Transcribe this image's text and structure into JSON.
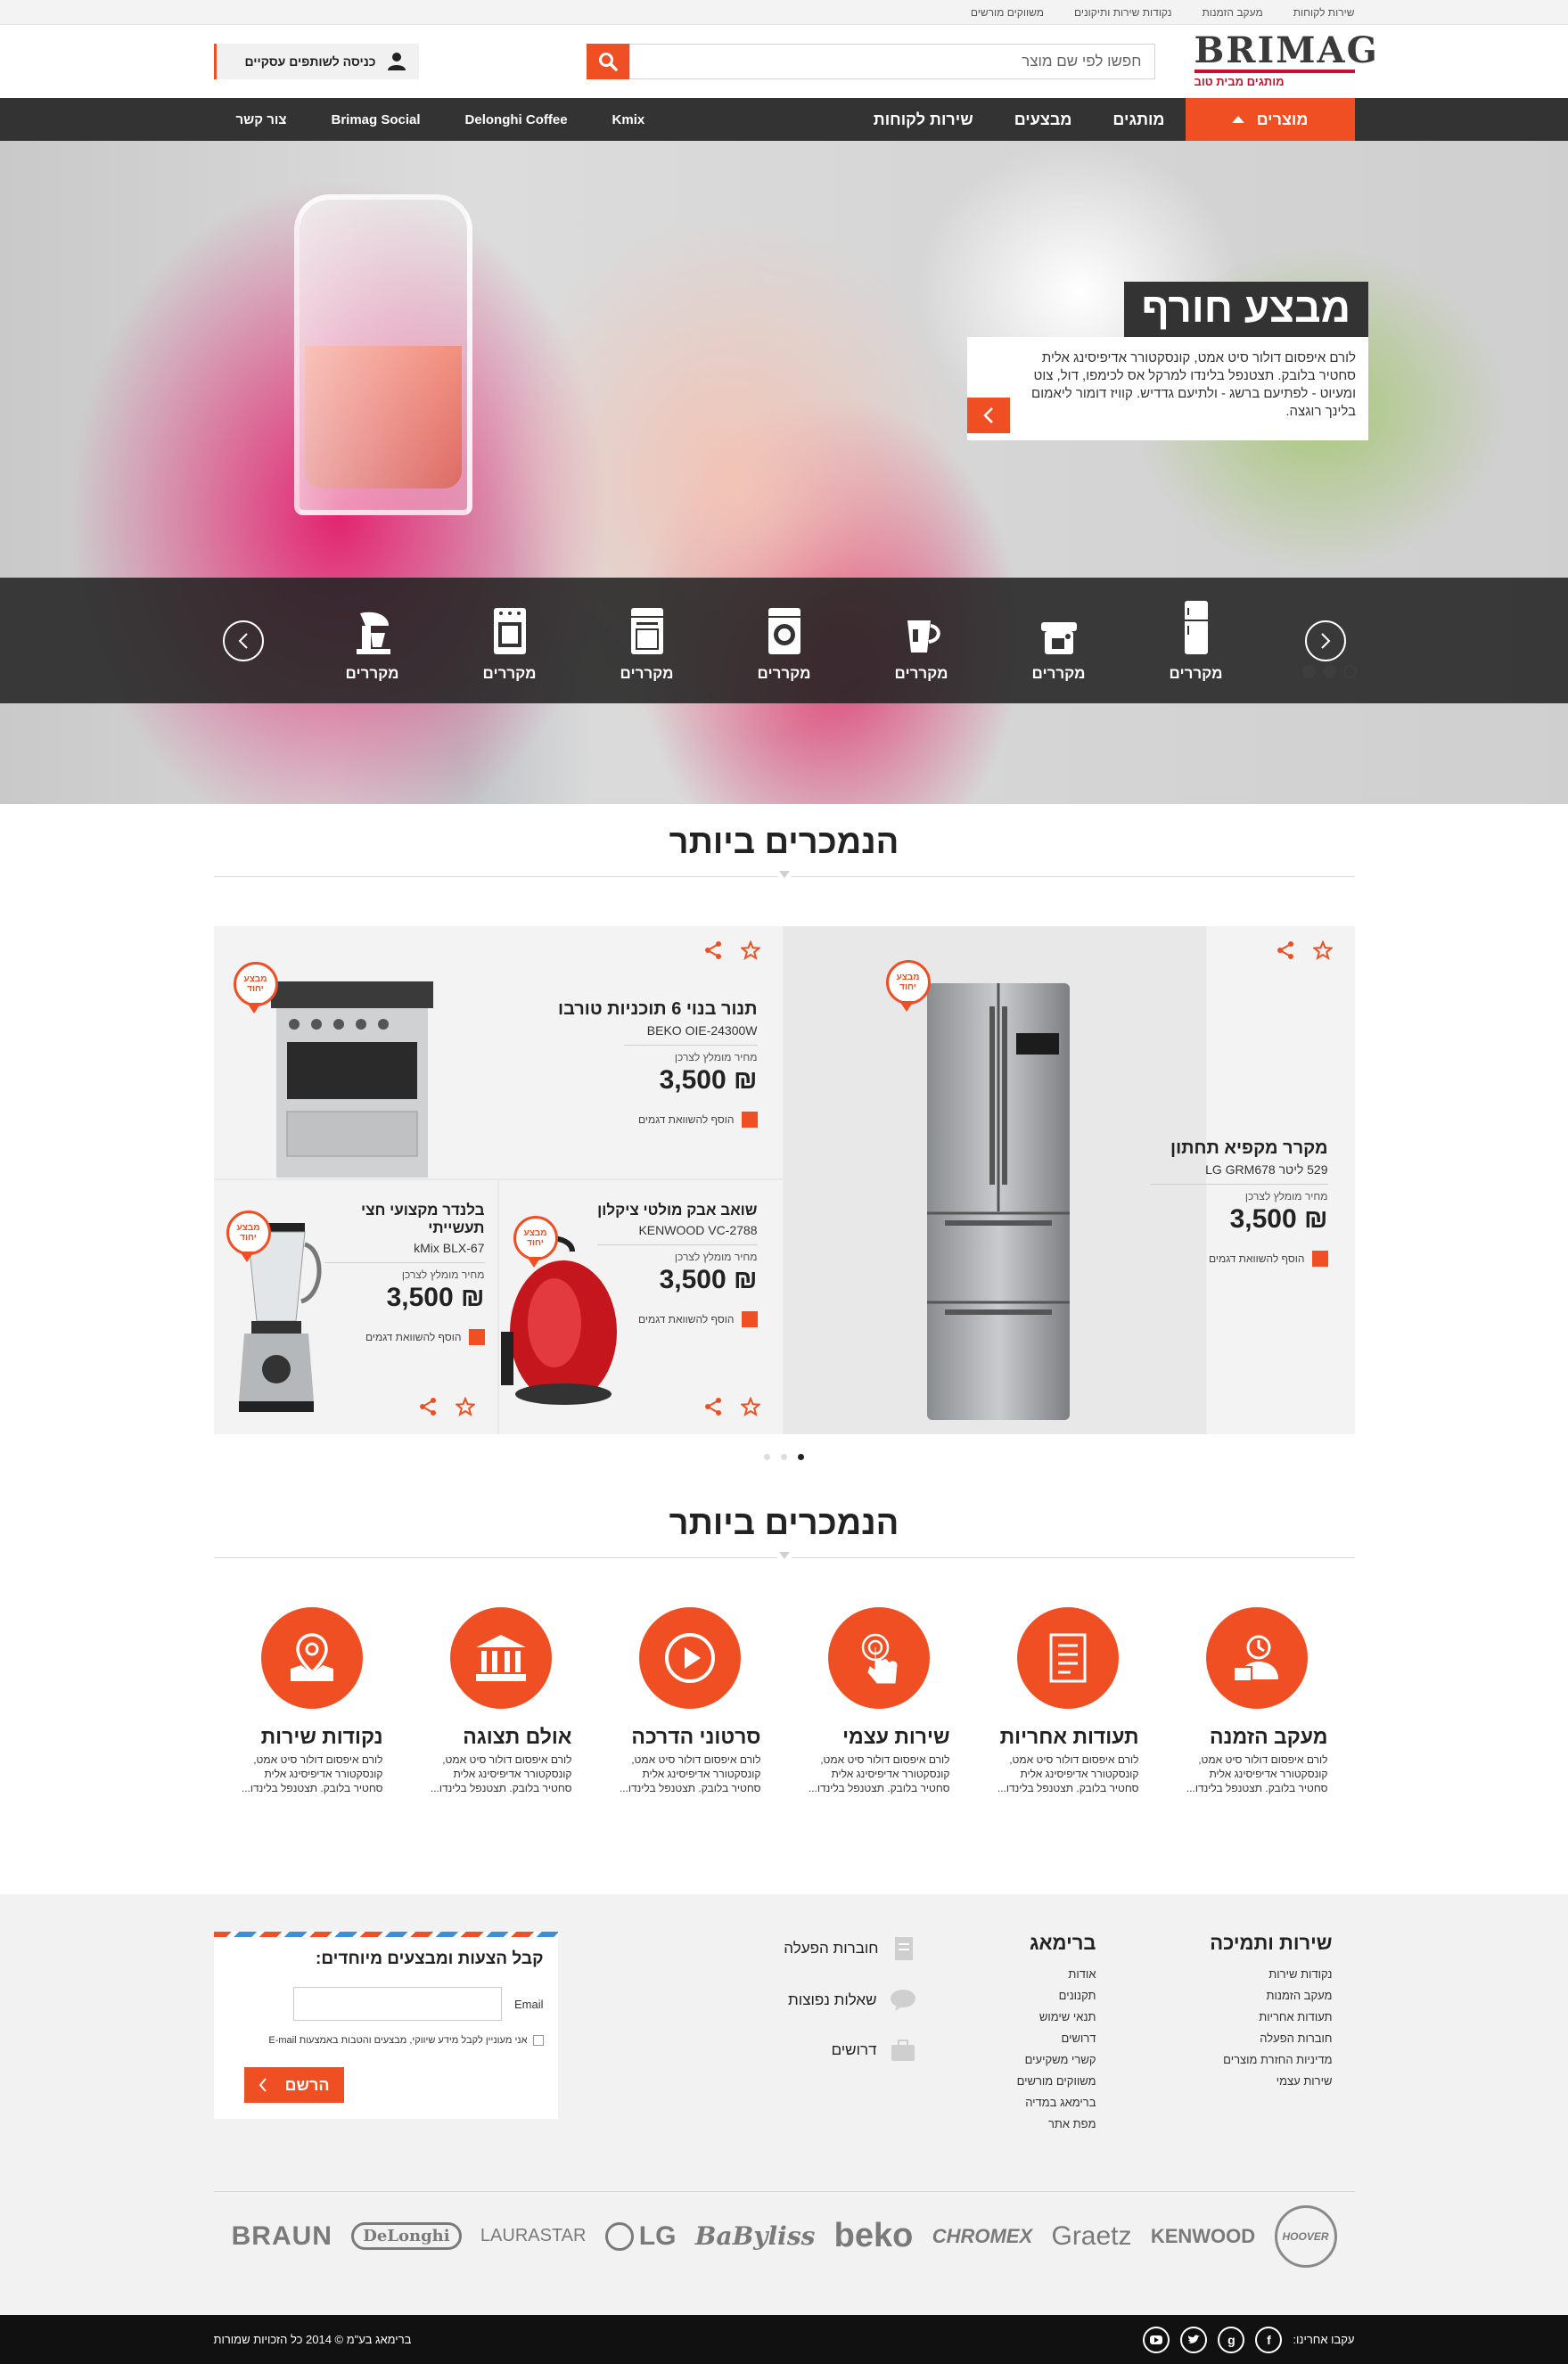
{
  "topbar": {
    "links": [
      "שירות לקוחות",
      "מעקב הזמנות",
      "נקודות שירות ותיקונים",
      "משווקים מורשים"
    ]
  },
  "header": {
    "logo_text": "BRIMAG",
    "logo_tagline": "מותגים מבית טוב",
    "search_placeholder": "חפשו לפי שם מוצר",
    "biz_login": "כניסה לשותפים עסקיים"
  },
  "nav": {
    "items": [
      "מוצרים",
      "מותגים",
      "מבצעים",
      "שירות לקוחות"
    ],
    "left_items": [
      "Kmix",
      "Delonghi Coffee",
      "Brimag Social",
      "צור קשר"
    ]
  },
  "hero": {
    "promo_title": "מבצע חורף",
    "promo_text": "לורם איפסום דולור סיט אמט, קונסקטורר אדיפיסינג אלית סחטיר בלובק. תצטנפל בלינדו למרקל אס לכימפו, דול, צוט ומעיוט - לפתיעם ברשג - ולתיעם גדדיש. קוויז דומור ליאמום בלינך רוגצה.",
    "categories": [
      {
        "label": "מקררים",
        "icon": "fridge-icon"
      },
      {
        "label": "מקררים",
        "icon": "coffee-machine-icon"
      },
      {
        "label": "מקררים",
        "icon": "kettle-icon"
      },
      {
        "label": "מקררים",
        "icon": "washing-machine-icon"
      },
      {
        "label": "מקררים",
        "icon": "dishwasher-icon"
      },
      {
        "label": "מקררים",
        "icon": "oven-icon"
      },
      {
        "label": "מקררים",
        "icon": "mixer-icon"
      }
    ]
  },
  "bestsellers": {
    "title": "הנמכרים ביותר",
    "badge": "מבצע יחוד",
    "price_label": "מחיר מומלץ לצרכן",
    "compare_label": "הוסף להשוואת דגמים",
    "products": [
      {
        "name": "מקרר מקפיא תחתון",
        "model": "529 ליטר  LG GRM678",
        "price": "₪ 3,500"
      },
      {
        "name": "תנור בנוי 6 תוכניות טורבו",
        "model": "BEKO OIE-24300W",
        "price": "₪ 3,500"
      },
      {
        "name": "שואב אבק מולטי ציקלון",
        "model": "KENWOOD VC-2788",
        "price": "₪ 3,500"
      },
      {
        "name": "בלנדר מקצועי חצי תעשייתי",
        "model": "kMix BLX-67",
        "price": "₪ 3,500"
      }
    ]
  },
  "services": {
    "title": "הנמכרים ביותר",
    "text": "לורם איפסום דולור סיט אמט, קונסקטורר אדיפיסינג אלית סחטיר בלובק. תצטנפל בלינדו...",
    "items": [
      {
        "title": "מעקב הזמנה",
        "icon": "order-tracking-icon"
      },
      {
        "title": "תעודות אחריות",
        "icon": "warranty-document-icon"
      },
      {
        "title": "שירות עצמי",
        "icon": "self-service-icon"
      },
      {
        "title": "סרטוני הדרכה",
        "icon": "play-video-icon"
      },
      {
        "title": "אולם תצוגה",
        "icon": "showroom-icon"
      },
      {
        "title": "נקודות שירות",
        "icon": "map-pin-icon"
      }
    ]
  },
  "footer": {
    "col1": {
      "title": "שירות ותמיכה",
      "items": [
        "נקודות שירות",
        "מעקב הזמנות",
        "תעודות אחריות",
        "חוברות הפעלה",
        "מדיניות החזרת מוצרים",
        "שירות עצמי"
      ]
    },
    "col2": {
      "title": "ברימאג",
      "items": [
        "אודות",
        "תקנונים",
        "תנאי שימוש",
        "דרושים",
        "קשרי משקיעים",
        "משווקים מורשים",
        "ברימאג במדיה",
        "מפת אתר"
      ]
    },
    "links": [
      "חוברות הפעלה",
      "שאלות נפוצות",
      "דרושים"
    ],
    "newsletter": {
      "title": "קבל הצעות ומבצעים מיוחדים:",
      "email_label": "Email",
      "consent": "אני מעוניין לקבל מידע שיווקי, מבצעים והטבות באמצעות E-mail",
      "button": "הרשם"
    },
    "brands": [
      "HOOVER",
      "KENWOOD",
      "Graetz",
      "CHROMEX",
      "beko",
      "BaByliss",
      "LG",
      "LAURASTAR",
      "DeLonghi",
      "BRAUN"
    ]
  },
  "bottom": {
    "follow": "עקבו אחרינו:",
    "copyright": "ברימאג בע\"מ © 2014 כל הזכויות שמורות"
  },
  "colors": {
    "accent": "#f04e23",
    "dark": "#333333",
    "brand_red": "#c8102e"
  }
}
